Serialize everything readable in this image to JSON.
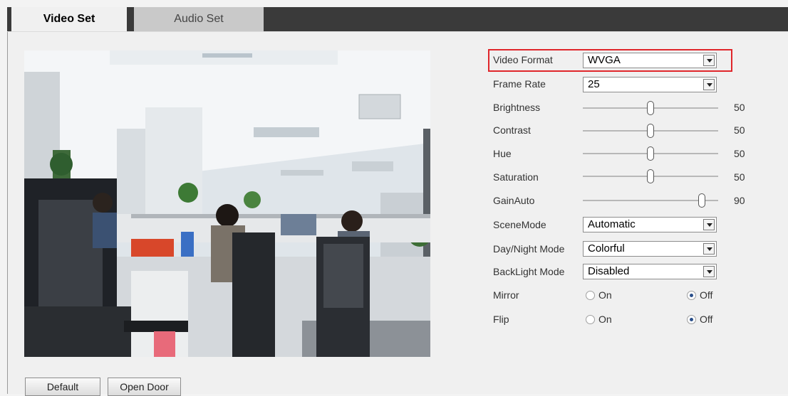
{
  "tabs": {
    "video": "Video Set",
    "audio": "Audio Set"
  },
  "settings": {
    "video_format": {
      "label": "Video Format",
      "value": "WVGA"
    },
    "frame_rate": {
      "label": "Frame Rate",
      "value": "25"
    },
    "brightness": {
      "label": "Brightness",
      "value": "50",
      "level": 50
    },
    "contrast": {
      "label": "Contrast",
      "value": "50",
      "level": 50
    },
    "hue": {
      "label": "Hue",
      "value": "50",
      "level": 50
    },
    "saturation": {
      "label": "Saturation",
      "value": "50",
      "level": 50
    },
    "gain_auto": {
      "label": "GainAuto",
      "value": "90",
      "level": 90
    },
    "scene_mode": {
      "label": "SceneMode",
      "value": "Automatic"
    },
    "day_night_mode": {
      "label": "Day/Night Mode",
      "value": "Colorful"
    },
    "backlight_mode": {
      "label": "BackLight Mode",
      "value": "Disabled"
    },
    "mirror": {
      "label": "Mirror",
      "on": "On",
      "off": "Off",
      "selected": "Off"
    },
    "flip": {
      "label": "Flip",
      "on": "On",
      "off": "Off",
      "selected": "Off"
    }
  },
  "buttons": {
    "default": "Default",
    "open_door": "Open Door"
  },
  "colors": {
    "highlight": "#e0262b",
    "tabbar": "#3a3a3a"
  }
}
